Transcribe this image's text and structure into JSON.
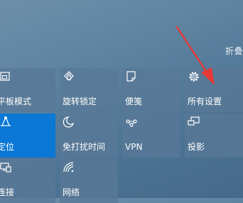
{
  "header": {
    "collapse_label": "折叠"
  },
  "tiles": [
    {
      "label": "平板模式",
      "icon": "tablet-mode-icon",
      "active": false
    },
    {
      "label": "旋转锁定",
      "icon": "rotation-lock-icon",
      "active": false
    },
    {
      "label": "便笺",
      "icon": "note-icon",
      "active": false
    },
    {
      "label": "所有设置",
      "icon": "gear-icon",
      "active": false
    },
    {
      "label": "定位",
      "icon": "location-icon",
      "active": true
    },
    {
      "label": "免打扰时间",
      "icon": "moon-icon",
      "active": false
    },
    {
      "label": "VPN",
      "icon": "vpn-icon",
      "active": false
    },
    {
      "label": "投影",
      "icon": "project-icon",
      "active": false
    },
    {
      "label": "连接",
      "icon": "connect-icon",
      "active": false
    },
    {
      "label": "网络",
      "icon": "network-icon",
      "active": false
    }
  ],
  "colors": {
    "active_tile": "#0a78d4",
    "tile": "#587896",
    "annotation_arrow": "#e53935"
  }
}
